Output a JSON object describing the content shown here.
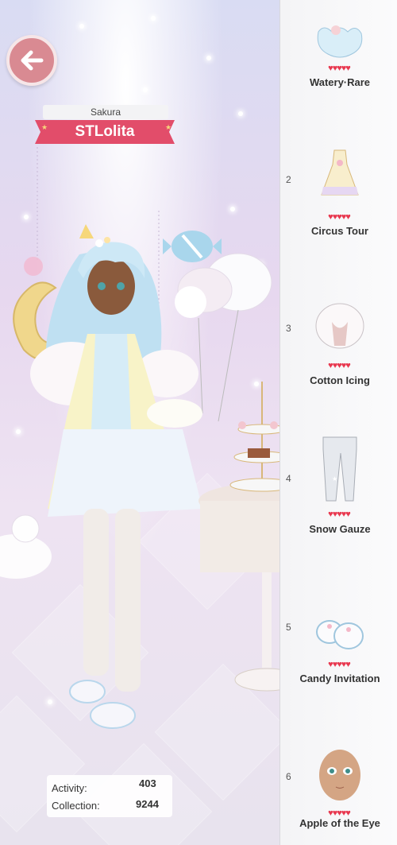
{
  "header": {
    "player_name": "Sakura",
    "style_tag": "STLolita"
  },
  "stats": {
    "activity_label": "Activity:",
    "activity_value": "403",
    "collection_label": "Collection:",
    "collection_value": "9244"
  },
  "items": [
    {
      "rank": "",
      "name": "Watery·Rare",
      "hearts": "♥♥♥♥♥"
    },
    {
      "rank": "2",
      "name": "Circus Tour",
      "hearts": "♥♥♥♥♥"
    },
    {
      "rank": "3",
      "name": "Cotton Icing",
      "hearts": "♥♥♥♥♥"
    },
    {
      "rank": "4",
      "name": "Snow Gauze",
      "hearts": "♥♥♥♥♥"
    },
    {
      "rank": "5",
      "name": "Candy Invitation",
      "hearts": "♥♥♥♥♥"
    },
    {
      "rank": "6",
      "name": "Apple of the Eye",
      "hearts": "♥♥♥♥♥"
    }
  ],
  "colors": {
    "ribbon": "#e24d6a",
    "back_button": "#d98a92",
    "hearts": "#e8384f"
  },
  "icons": {
    "back": "arrow-left-icon"
  }
}
